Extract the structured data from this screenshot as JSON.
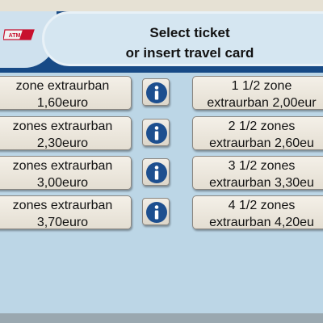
{
  "header": {
    "logo_text": "ATM",
    "title_line1": "Select ticket",
    "title_line2": "or insert travel card"
  },
  "tickets_left": [
    {
      "line1": "zone extraurban",
      "line2": "1,60euro"
    },
    {
      "line1": "zones extraurban",
      "line2": "2,30euro"
    },
    {
      "line1": "zones extraurban",
      "line2": "3,00euro"
    },
    {
      "line1": "zones extraurban",
      "line2": "3,70euro"
    }
  ],
  "tickets_right": [
    {
      "line1": "1 1/2 zone",
      "line2": "extraurban 2,00eur"
    },
    {
      "line1": "2 1/2 zones",
      "line2": "extraurban 2,60eu"
    },
    {
      "line1": "3 1/2 zones",
      "line2": "extraurban 3,30eu"
    },
    {
      "line1": "4 1/2 zones",
      "line2": "extraurban 4,20eu"
    }
  ],
  "info_icon": "info-icon",
  "colors": {
    "header_blue": "#174a86",
    "background": "#bcd6e6",
    "button": "#ece7dd",
    "info_icon": "#1d4f8f"
  }
}
